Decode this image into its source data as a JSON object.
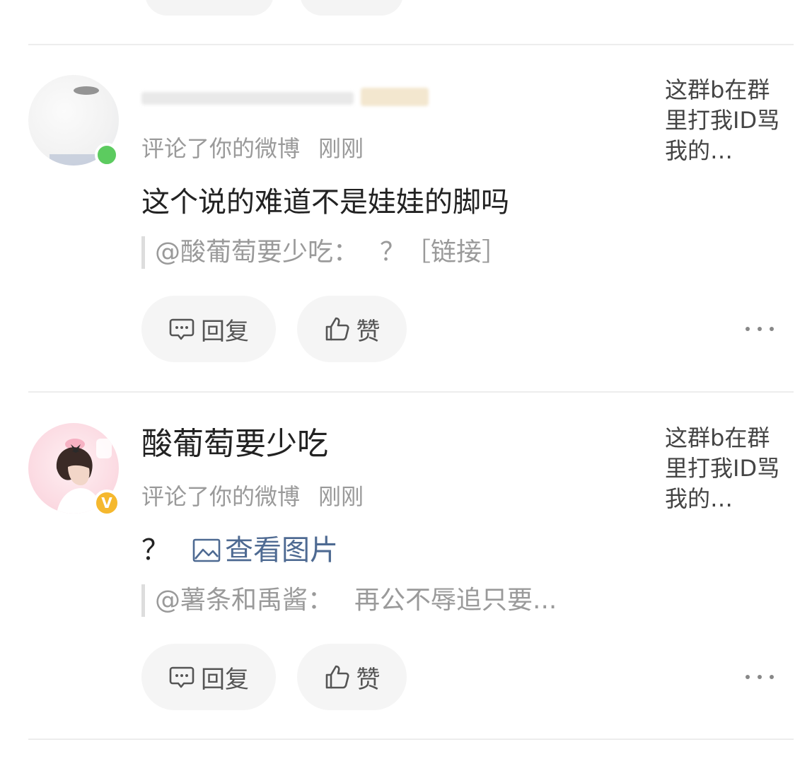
{
  "top_stubs": [
    "",
    ""
  ],
  "notifications": [
    {
      "user_name": "",
      "name_obscured": true,
      "avatar_badge": "online-dot",
      "action_text": "评论了你的微博",
      "time": "刚刚",
      "comment": "这个说的难道不是娃娃的脚吗",
      "image_link_label": "",
      "quote_prefix": "@酸葡萄要少吃：",
      "quote_body": "？［链接］",
      "preview": "这群b在群里打我ID骂我的…",
      "reply_label": "回复",
      "like_label": "赞"
    },
    {
      "user_name": "酸葡萄要少吃",
      "name_obscured": false,
      "avatar_badge": "V",
      "action_text": "评论了你的微博",
      "time": "刚刚",
      "comment": "？",
      "image_link_label": "查看图片",
      "quote_prefix": "@薯条和禹酱：",
      "quote_body": "再公不辱追只要...",
      "preview": "这群b在群里打我ID骂我的…",
      "reply_label": "回复",
      "like_label": "赞"
    }
  ],
  "colors": {
    "link": "#4e6a92",
    "online": "#5ccb5f",
    "vip": "#f5b82e",
    "button_bg": "#f5f5f5",
    "meta_text": "#9a9a9a"
  },
  "icons": {
    "reply": "comment-bubble-icon",
    "like": "thumbs-up-icon",
    "image": "image-icon",
    "more": "more-dots-icon"
  }
}
